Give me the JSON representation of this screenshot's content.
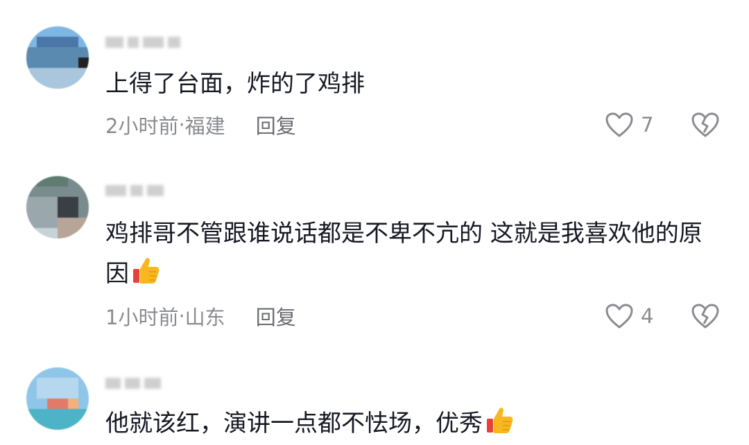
{
  "comments": [
    {
      "text": "上得了台面，炸的了鸡排",
      "time": "2小时前",
      "location": "福建",
      "reply_label": "回复",
      "likes": "7",
      "emoji": false
    },
    {
      "text": "鸡排哥不管跟谁说话都是不卑不亢的 这就是我喜欢他的原因",
      "time": "1小时前",
      "location": "山东",
      "reply_label": "回复",
      "likes": "4",
      "emoji": "thumbs-up"
    },
    {
      "text": "他就该红，演讲一点都不怯场，优秀",
      "emoji": "thumbs-up"
    }
  ],
  "separator": " · ",
  "icons": {
    "like": "heart-outline-icon",
    "dislike": "broken-heart-icon",
    "emoji": "thumbs-up-emoji"
  },
  "colors": {
    "text": "#161823",
    "meta": "#8a8b91",
    "thumb": "#f7b71d"
  }
}
